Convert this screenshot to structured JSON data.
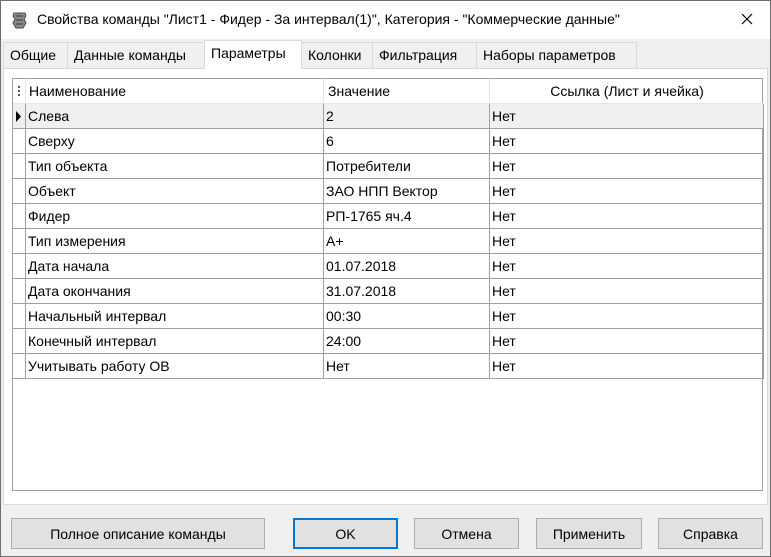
{
  "window": {
    "title": "Свойства команды \"Лист1 - Фидер - За интервал(1)\", Категория - \"Коммерческие данные\"",
    "app_icon": "app-icon",
    "close_icon": "close-icon"
  },
  "tabs": [
    {
      "label": "Общие",
      "active": false
    },
    {
      "label": "Данные команды",
      "active": false
    },
    {
      "label": "Параметры",
      "active": true
    },
    {
      "label": "Колонки",
      "active": false
    },
    {
      "label": "Фильтрация",
      "active": false
    },
    {
      "label": "Наборы параметров",
      "active": false
    }
  ],
  "grid": {
    "columns": [
      "Наименование",
      "Значение",
      "Ссылка (Лист и ячейка)"
    ],
    "rows": [
      {
        "name": "Слева",
        "value": "2",
        "link": "Нет"
      },
      {
        "name": "Сверху",
        "value": "6",
        "link": "Нет"
      },
      {
        "name": "Тип объекта",
        "value": "Потребители",
        "link": "Нет"
      },
      {
        "name": "Объект",
        "value": "ЗАО НПП Вектор",
        "link": "Нет"
      },
      {
        "name": "Фидер",
        "value": "РП-1765 яч.4",
        "link": "Нет"
      },
      {
        "name": "Тип измерения",
        "value": "А+",
        "link": "Нет"
      },
      {
        "name": "Дата начала",
        "value": "01.07.2018",
        "link": "Нет"
      },
      {
        "name": "Дата окончания",
        "value": "31.07.2018",
        "link": "Нет"
      },
      {
        "name": "Начальный интервал",
        "value": "00:30",
        "link": "Нет"
      },
      {
        "name": "Конечный интервал",
        "value": "24:00",
        "link": "Нет"
      },
      {
        "name": "Учитывать работу ОВ",
        "value": "Нет",
        "link": "Нет"
      }
    ],
    "selected_row": 0
  },
  "buttons": {
    "full_description": "Полное описание команды",
    "ok": "OK",
    "cancel": "Отмена",
    "apply": "Применить",
    "help": "Справка"
  },
  "colors": {
    "accent": "#0078d7",
    "selected_row": "#f0f0f0",
    "button_face": "#e1e1e1"
  }
}
